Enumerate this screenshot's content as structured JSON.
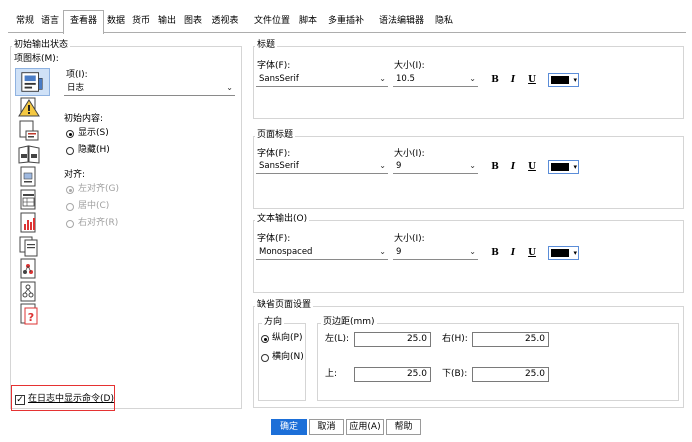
{
  "tabs": [
    "常规",
    "语言",
    "查看器",
    "数据",
    "货币",
    "输出",
    "图表",
    "透视表",
    "文件位置",
    "脚本",
    "多重插补",
    "语法编辑器",
    "隐私"
  ],
  "active_tab": "查看器",
  "left": {
    "group_title": "初始输出状态",
    "icon_label": "项图标(M):",
    "item_label": "项(I):",
    "item_value": "日志",
    "initial_content_label": "初始内容:",
    "show": "显示(S)",
    "hide": "隐藏(H)",
    "align_label": "对齐:",
    "align_left": "左对齐(G)",
    "align_center": "居中(C)",
    "align_right": "右对齐(R)",
    "icons": [
      "viewer-page-icon",
      "warning-icon",
      "notes-icon",
      "title-book-icon",
      "page-title-icon",
      "table-icon",
      "chart-icon",
      "text-output-icon",
      "tree-model-icon",
      "tree-diagram-icon",
      "unknown-object-icon"
    ],
    "show_commands": "在日志中显示命令(D)",
    "show_commands_checked": true
  },
  "font_size_label": "大小(I):",
  "title_group": {
    "title": "标题",
    "font_label": "字体(F):",
    "font": "SansSerif",
    "size": "10.5"
  },
  "page_title_group": {
    "title": "页面标题",
    "font_label": "字体(F):",
    "font": "SansSerif",
    "size": "9"
  },
  "text_output_group": {
    "title": "文本输出(O)",
    "font_label": "字体(F):",
    "font": "Monospaced",
    "size": "9"
  },
  "format_buttons": {
    "bold": "B",
    "italic": "I",
    "underline": "U"
  },
  "colors": {
    "text_color": "#000000",
    "accent": "#1c6fd8",
    "highlight": "#e53232"
  },
  "page_setup": {
    "title": "缺省页面设置",
    "orientation_title": "方向",
    "portrait": "纵向(P)",
    "landscape": "横向(N)",
    "margins_title": "页边距(mm)",
    "left_label": "左(L):",
    "left_value": "25.0",
    "right_label": "右(H):",
    "right_value": "25.0",
    "top_label": "上:",
    "top_value": "25.0",
    "bottom_label": "下(B):",
    "bottom_value": "25.0"
  },
  "buttons": {
    "ok": "确定",
    "cancel": "取消",
    "apply": "应用(A)",
    "help": "帮助"
  }
}
